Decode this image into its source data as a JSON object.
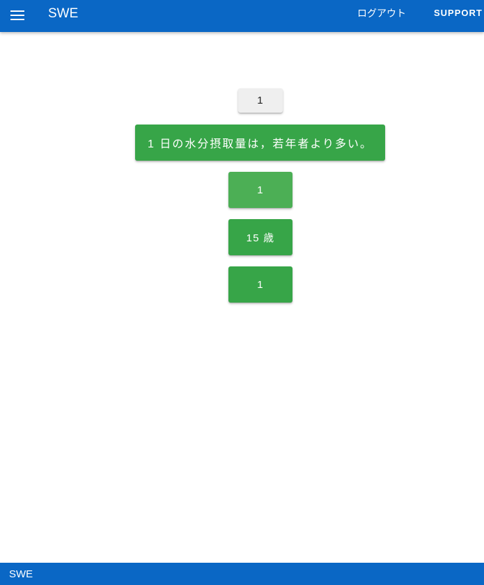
{
  "header": {
    "title": "SWE",
    "menu_icon": "hamburger-menu-icon",
    "logout_label": "ログアウト",
    "support_label": "SUPPORT"
  },
  "main": {
    "counter_label": "1",
    "question_label": "1 日の水分摂取量は，若年者より多い。",
    "answers": [
      {
        "label": "1"
      },
      {
        "label": "15 歳"
      },
      {
        "label": "1"
      }
    ]
  },
  "footer": {
    "text": "SWE"
  },
  "colors": {
    "appbar": "#0a67c5",
    "button_green": "#37a548",
    "button_green_hover": "#4caf55",
    "button_grey": "#efefef"
  }
}
